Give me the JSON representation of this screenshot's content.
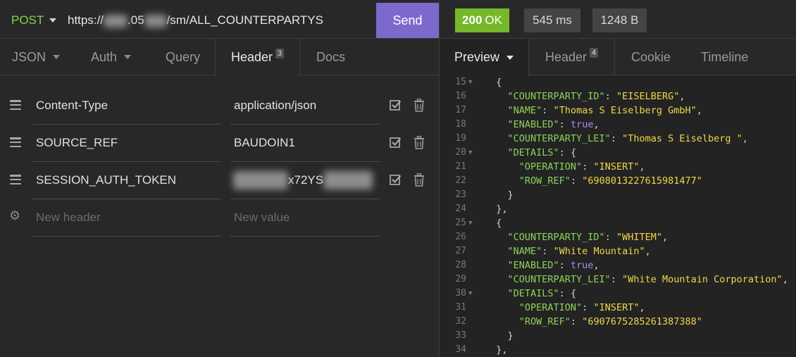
{
  "request": {
    "method": "POST",
    "url_prefix": "https://",
    "url_mid": ".05",
    "url_suffix": "/sm/ALL_COUNTERPARTYS",
    "send_label": "Send"
  },
  "request_tabs": [
    {
      "label": "JSON"
    },
    {
      "label": "Auth"
    },
    {
      "label": "Query"
    },
    {
      "label": "Header",
      "badge": "3"
    },
    {
      "label": "Docs"
    }
  ],
  "headers": [
    {
      "name": "Content-Type",
      "value": "application/json"
    },
    {
      "name": "SOURCE_REF",
      "value": "BAUDOIN1"
    },
    {
      "name": "SESSION_AUTH_TOKEN",
      "value": "x72YS"
    }
  ],
  "new_header": {
    "name_placeholder": "New header",
    "value_placeholder": "New value"
  },
  "response": {
    "status_code": "200",
    "status_text": "OK",
    "time": "545 ms",
    "size": "1248 B"
  },
  "response_tabs": [
    {
      "label": "Preview"
    },
    {
      "label": "Header",
      "badge": "4"
    },
    {
      "label": "Cookie"
    },
    {
      "label": "Timeline"
    }
  ],
  "colors": {
    "accent_purple": "#7d69cb",
    "status_green": "#76b82a",
    "json_key": "#8cd35a",
    "json_string": "#f0d74a",
    "json_bool": "#a78ff0"
  },
  "code_lines": [
    {
      "n": "15",
      "fold": true,
      "t": "  {"
    },
    {
      "n": "16",
      "fold": false,
      "t": "    \"COUNTERPARTY_ID\": \"EISELBERG\","
    },
    {
      "n": "17",
      "fold": false,
      "t": "    \"NAME\": \"Thomas S Eiselberg GmbH\","
    },
    {
      "n": "18",
      "fold": false,
      "t": "    \"ENABLED\": true,"
    },
    {
      "n": "19",
      "fold": false,
      "t": "    \"COUNTERPARTY_LEI\": \"Thomas S Eiselberg \","
    },
    {
      "n": "20",
      "fold": true,
      "t": "    \"DETAILS\": {"
    },
    {
      "n": "21",
      "fold": false,
      "t": "      \"OPERATION\": \"INSERT\","
    },
    {
      "n": "22",
      "fold": false,
      "t": "      \"ROW_REF\": \"6908013227615981477\""
    },
    {
      "n": "23",
      "fold": false,
      "t": "    }"
    },
    {
      "n": "24",
      "fold": false,
      "t": "  },"
    },
    {
      "n": "25",
      "fold": true,
      "t": "  {"
    },
    {
      "n": "26",
      "fold": false,
      "t": "    \"COUNTERPARTY_ID\": \"WHITEM\","
    },
    {
      "n": "27",
      "fold": false,
      "t": "    \"NAME\": \"White Mountain\","
    },
    {
      "n": "28",
      "fold": false,
      "t": "    \"ENABLED\": true,"
    },
    {
      "n": "29",
      "fold": false,
      "t": "    \"COUNTERPARTY_LEI\": \"White Mountain Corporation\","
    },
    {
      "n": "30",
      "fold": true,
      "t": "    \"DETAILS\": {"
    },
    {
      "n": "31",
      "fold": false,
      "t": "      \"OPERATION\": \"INSERT\","
    },
    {
      "n": "32",
      "fold": false,
      "t": "      \"ROW_REF\": \"6907675285261387388\""
    },
    {
      "n": "33",
      "fold": false,
      "t": "    }"
    },
    {
      "n": "34",
      "fold": false,
      "t": "  },"
    }
  ]
}
